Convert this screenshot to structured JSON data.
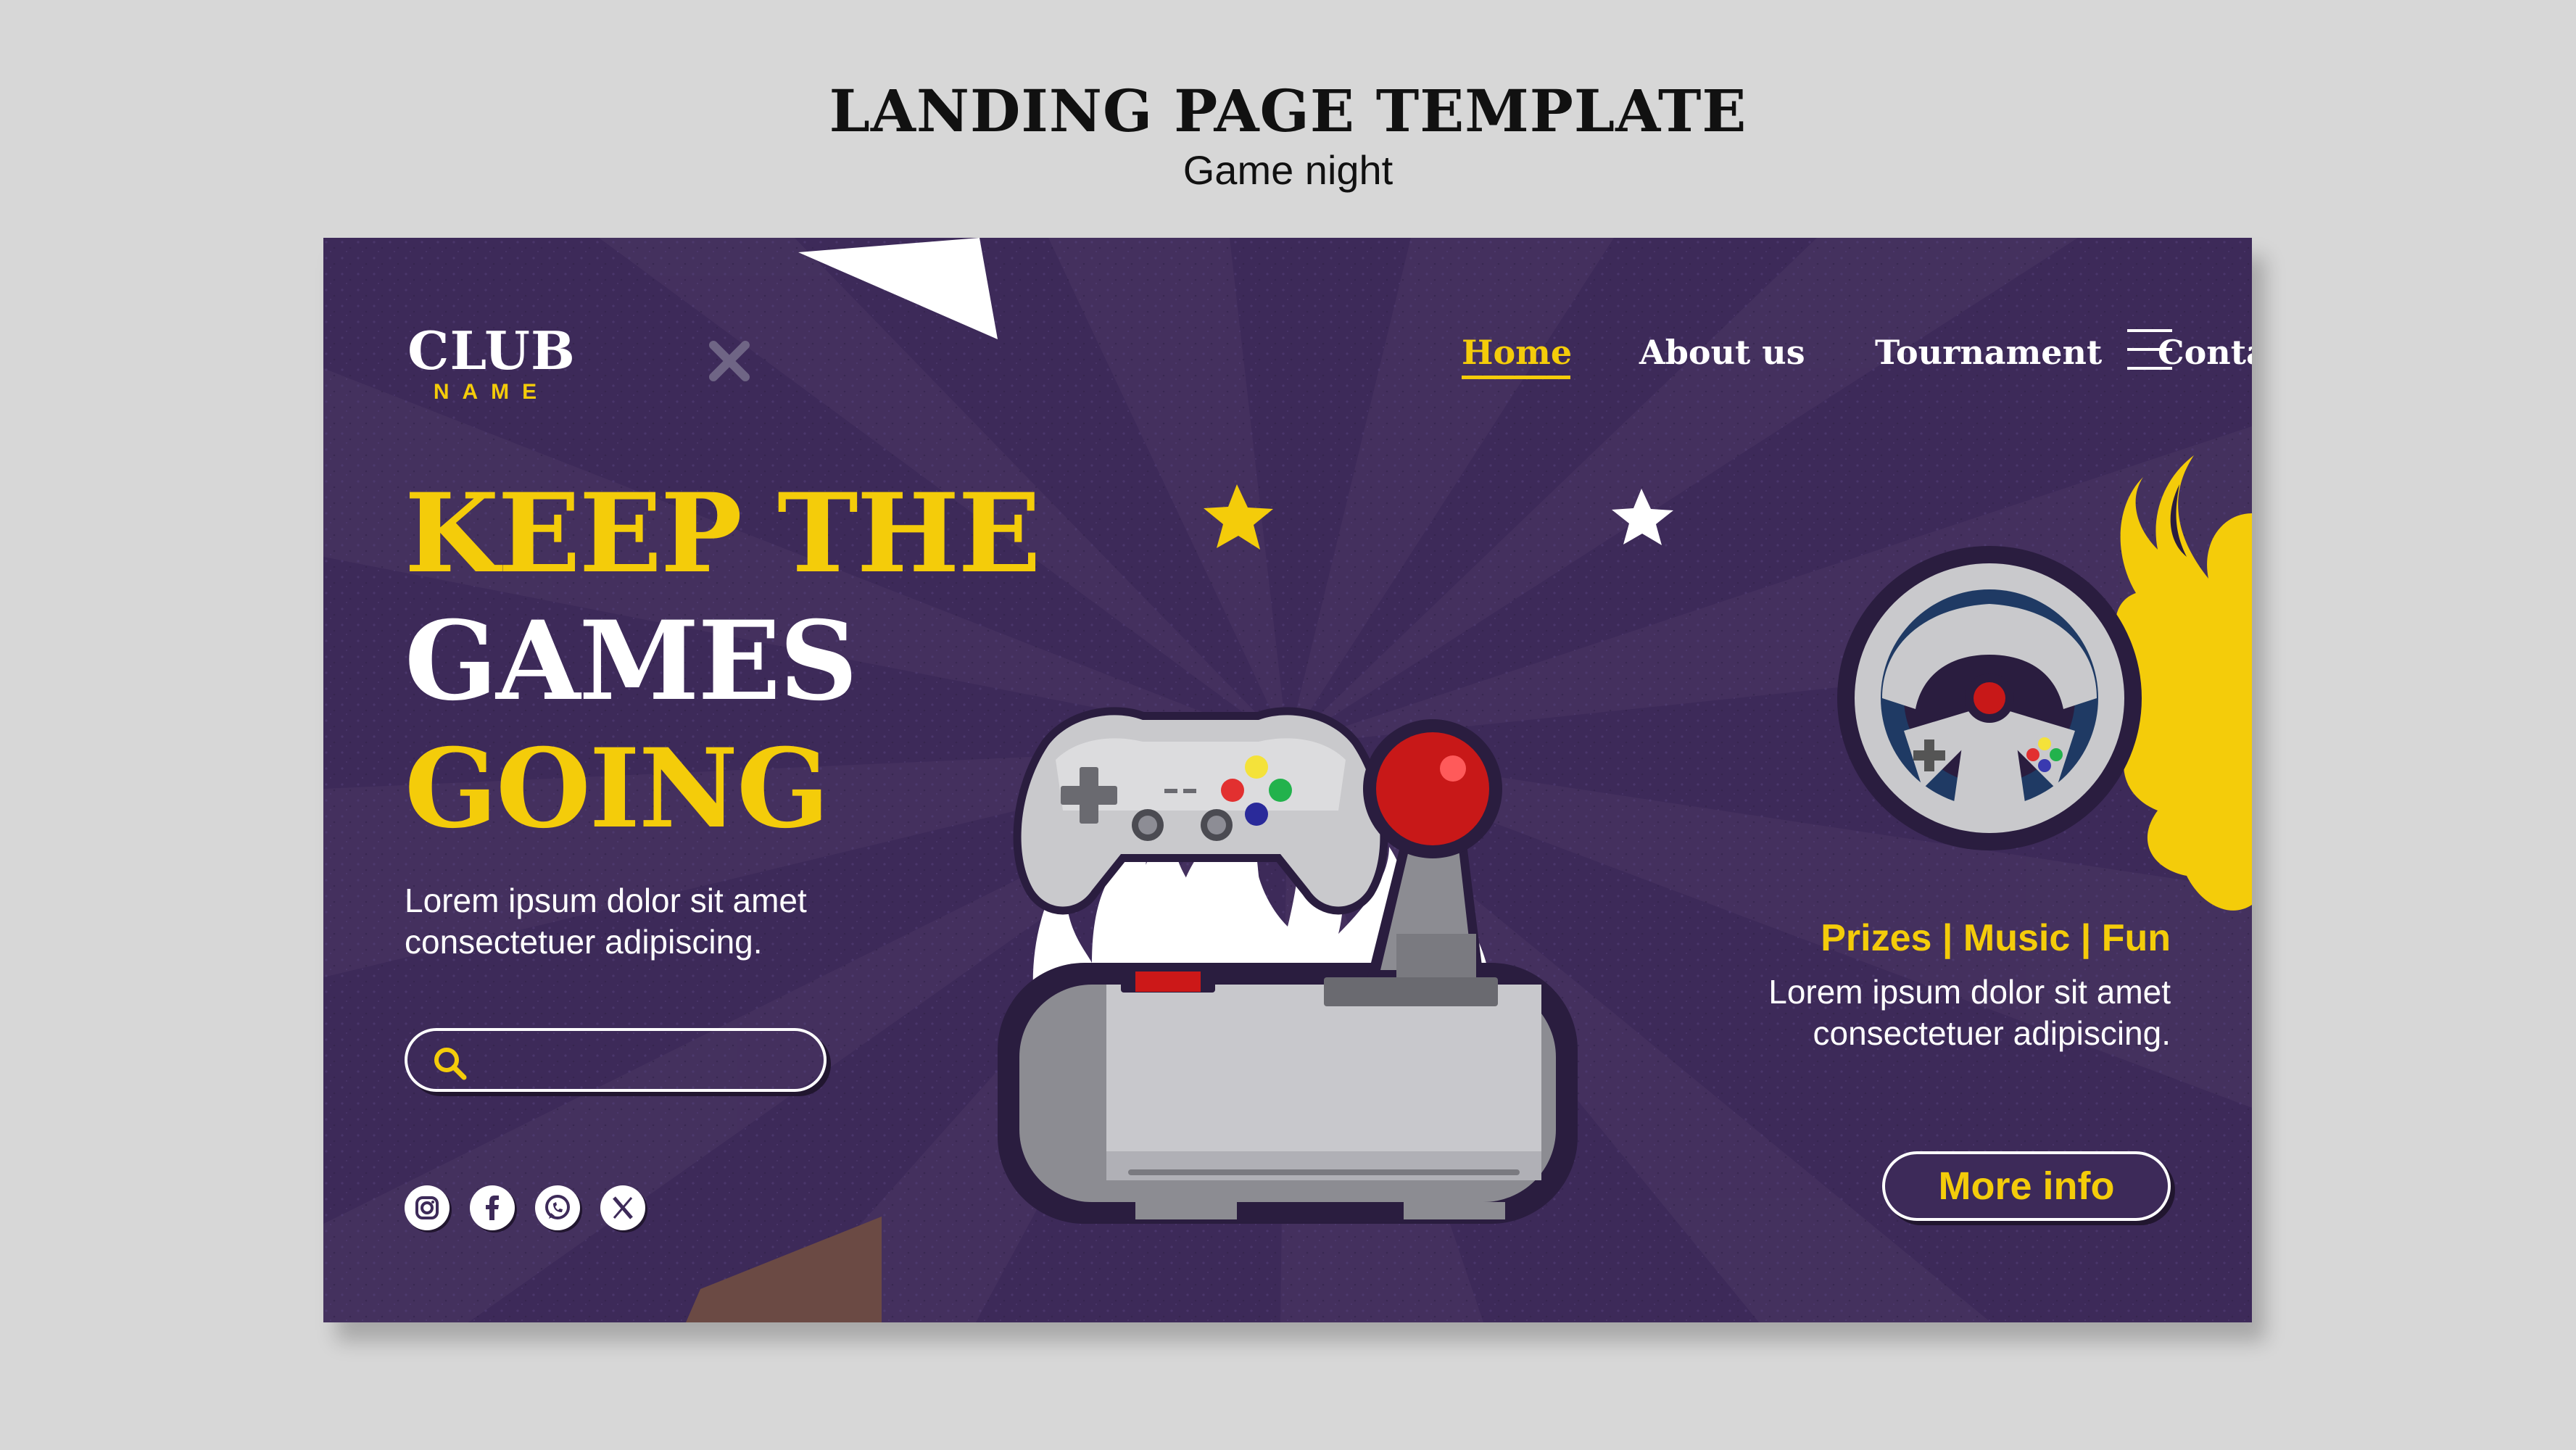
{
  "page_heading": {
    "title": "LANDING PAGE TEMPLATE",
    "subtitle": "Game night"
  },
  "logo": {
    "top": "CLUB",
    "bottom": "NAME"
  },
  "nav": {
    "items": [
      {
        "label": "Home",
        "active": true
      },
      {
        "label": "About us",
        "active": false
      },
      {
        "label": "Tournament",
        "active": false
      },
      {
        "label": "Contact us",
        "active": false
      }
    ],
    "menu_icon": "hamburger-icon"
  },
  "hero": {
    "line1": "KEEP THE",
    "line2": "GAMES",
    "line3": "GOING",
    "lede_line1": "Lorem ipsum dolor sit amet",
    "lede_line2": "consectetuer adipiscing."
  },
  "search": {
    "placeholder": "",
    "value": "",
    "icon": "search-icon"
  },
  "socials": [
    "instagram-icon",
    "facebook-icon",
    "whatsapp-icon",
    "x-icon"
  ],
  "right_panel": {
    "tagline": "Prizes | Music | Fun",
    "text_line1": "Lorem ipsum dolor sit amet",
    "text_line2": "consectetuer adipiscing.",
    "cta_label": "More info"
  },
  "colors": {
    "background": "#3d2a59",
    "accent": "#f4cc0a",
    "text": "#ffffff",
    "page": "#d7d7d7"
  }
}
